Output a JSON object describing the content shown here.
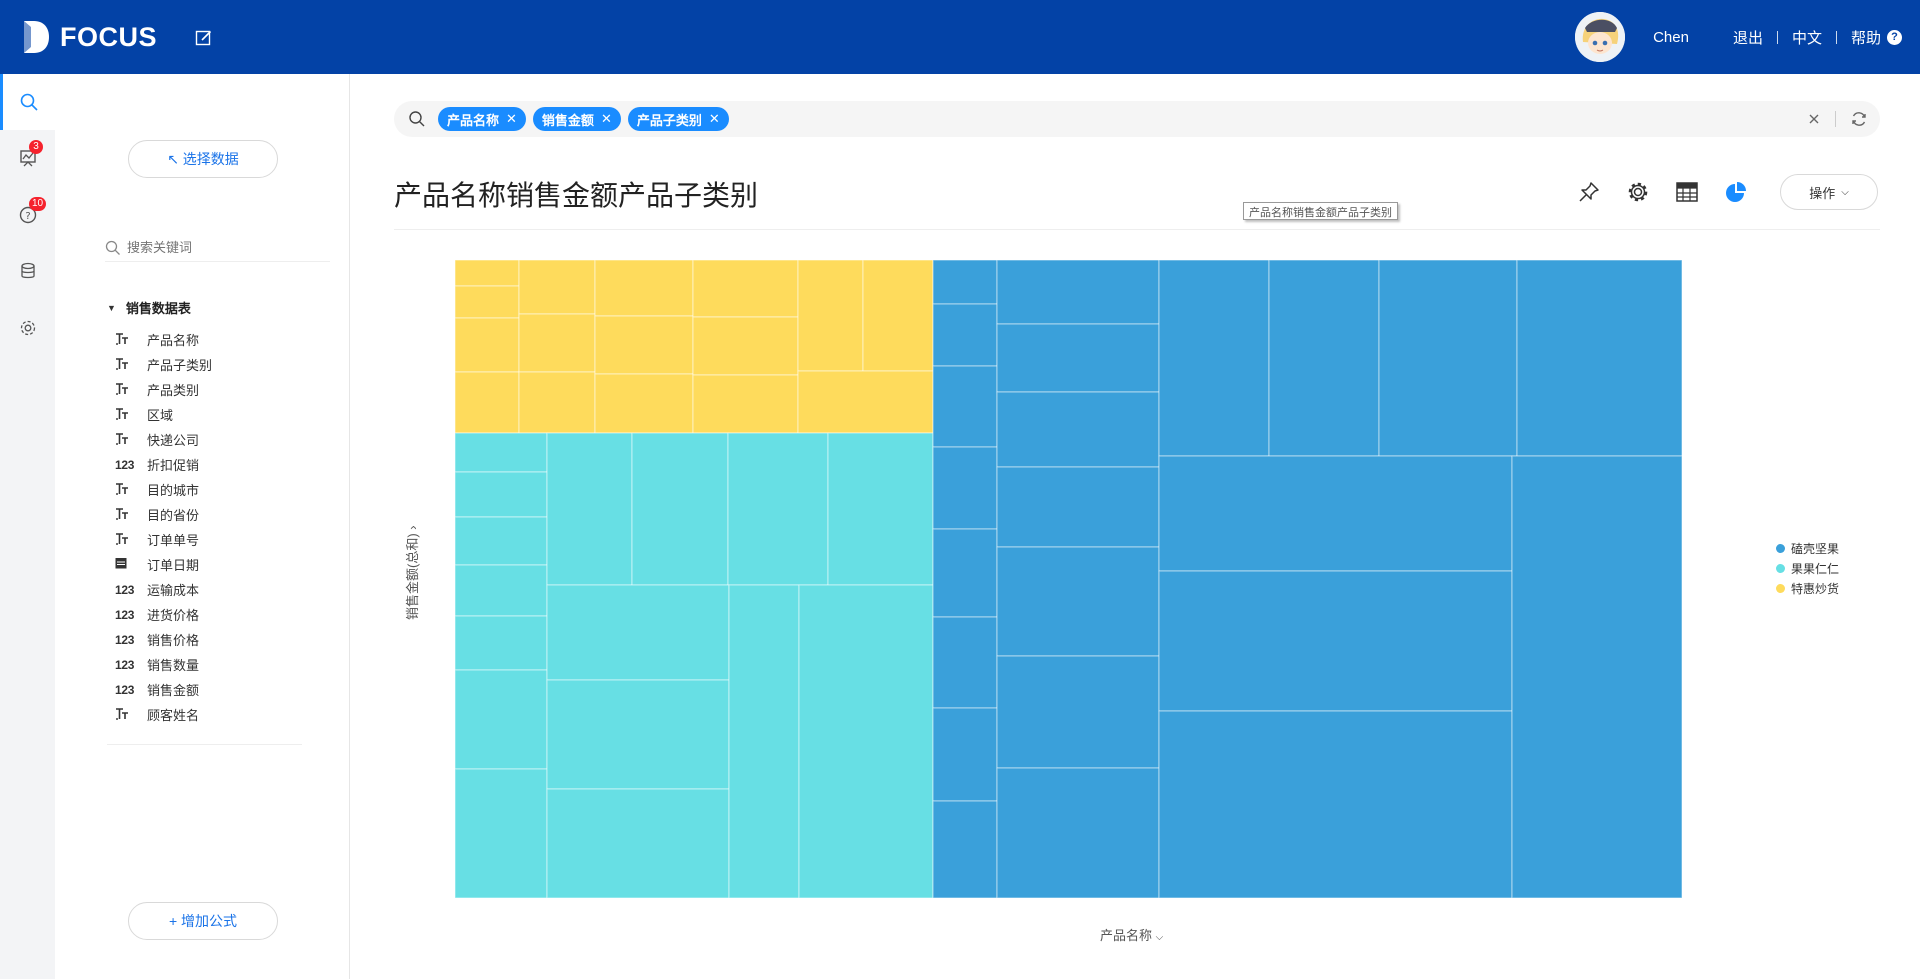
{
  "header": {
    "app_name": "FOCUS",
    "user_name": "Chen",
    "logout": "退出",
    "language": "中文",
    "help": "帮助",
    "brand_color": "#0342a6"
  },
  "rail": {
    "pinboard_badge": "3",
    "help_badge": "10"
  },
  "panel": {
    "select_data": "↖ 选择数据",
    "search_placeholder": "搜索关键词",
    "table_name": "销售数据表",
    "fields": [
      {
        "type": "text",
        "label": "产品名称"
      },
      {
        "type": "text",
        "label": "产品子类别"
      },
      {
        "type": "text",
        "label": "产品类别"
      },
      {
        "type": "text",
        "label": "区域"
      },
      {
        "type": "text",
        "label": "快递公司"
      },
      {
        "type": "number",
        "label": "折扣促销"
      },
      {
        "type": "text",
        "label": "目的城市"
      },
      {
        "type": "text",
        "label": "目的省份"
      },
      {
        "type": "text",
        "label": "订单单号"
      },
      {
        "type": "date",
        "label": "订单日期"
      },
      {
        "type": "number",
        "label": "运输成本"
      },
      {
        "type": "number",
        "label": "进货价格"
      },
      {
        "type": "number",
        "label": "销售价格"
      },
      {
        "type": "number",
        "label": "销售数量"
      },
      {
        "type": "number",
        "label": "销售金额"
      },
      {
        "type": "text",
        "label": "顾客姓名"
      }
    ],
    "number_type_glyph": "123",
    "add_formula": "+ 增加公式"
  },
  "query": {
    "chips": [
      "产品名称",
      "销售金额",
      "产品子类别"
    ],
    "clear_icon": "close-icon",
    "refresh_icon": "refresh-icon"
  },
  "main": {
    "title": "产品名称销售金额产品子类别",
    "tooltip": "产品名称销售金额产品子类别",
    "operations": "操作"
  },
  "chart_data": {
    "type": "treemap",
    "y_axis_label": "销售金额(总和)",
    "x_axis_label": "产品名称",
    "legend_position": "right",
    "series": [
      {
        "name": "磕壳坚果",
        "color": "#3aa0da"
      },
      {
        "name": "果果仁仁",
        "color": "#67dfe4"
      },
      {
        "name": "特惠炒货",
        "color": "#fedb5c"
      }
    ]
  }
}
